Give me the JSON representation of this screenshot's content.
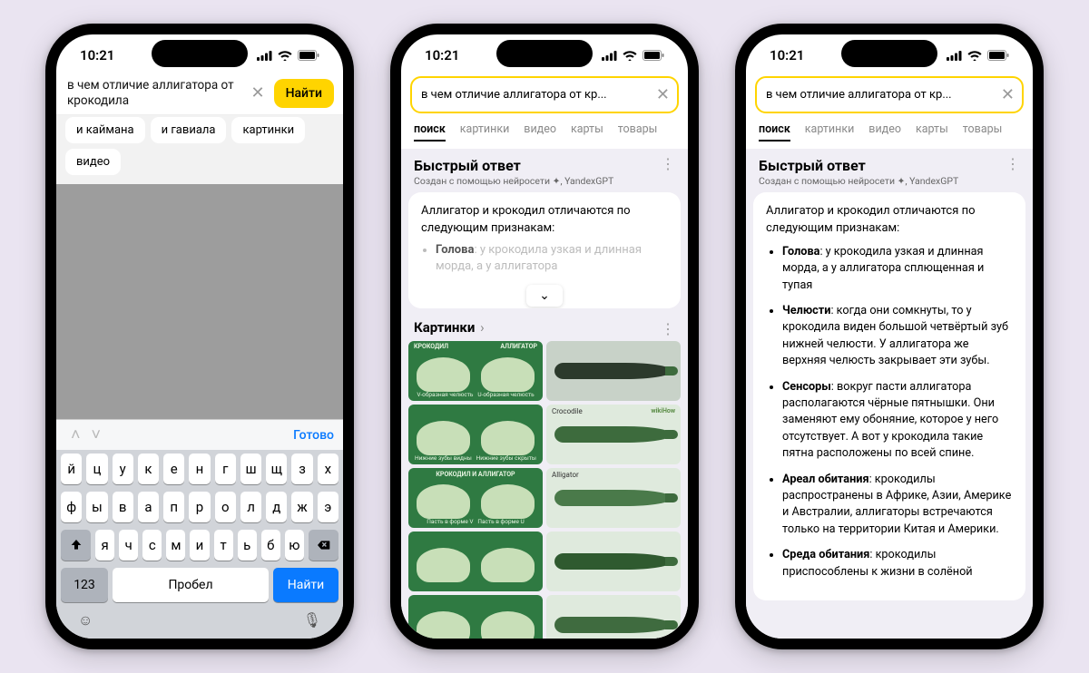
{
  "status": {
    "time": "10:21"
  },
  "phone1": {
    "query": "в чем отличие аллигатора от\nкрокодила",
    "search_button": "Найти",
    "chips": [
      "и каймана",
      "и гавиала",
      "картинки",
      "видео"
    ],
    "kbd_done": "Готово",
    "rows": [
      [
        "й",
        "ц",
        "у",
        "к",
        "е",
        "н",
        "г",
        "ш",
        "щ",
        "з",
        "х"
      ],
      [
        "ф",
        "ы",
        "в",
        "а",
        "п",
        "р",
        "о",
        "л",
        "д",
        "ж",
        "э"
      ],
      [
        "я",
        "ч",
        "с",
        "м",
        "и",
        "т",
        "ь",
        "б",
        "ю"
      ]
    ],
    "k123": "123",
    "space": "Пробел",
    "kfind": "Найти"
  },
  "search_query_short": "в чем отличие аллигатора от кр...",
  "tabs": [
    "поиск",
    "картинки",
    "видео",
    "карты",
    "товары"
  ],
  "answer": {
    "title": "Быстрый ответ",
    "subtitle": "Создан с помощью нейросети ✦, YandexGPT",
    "intro": "Аллигатор и крокодил отличаются по следующим признакам:",
    "teaser_head": "Голова",
    "teaser_text": ": у крокодила узкая и длинная морда, а у аллигатора",
    "points": [
      {
        "head": "Голова",
        "text": ": у крокодила узкая и длинная морда, а у аллигатора сплющенная и тупая"
      },
      {
        "head": "Челюсти",
        "text": ": когда они сомкнуты, то у крокодила виден большой четвёртый зуб нижней челюсти. У аллигатора же верхняя челюсть закрывает эти зубы."
      },
      {
        "head": "Сенсоры",
        "text": ": вокруг пасти аллигатора располагаются чёрные пятнышки. Они заменяют ему обоняние, которое у него отсутствует. А вот у крокодила такие пятна расположены по всей спине."
      },
      {
        "head": "Ареал обитания",
        "text": ": крокодилы распространены в Африке, Азии, Америке и Австралии, аллигаторы встречаются только на территории Китая и Америки."
      },
      {
        "head": "Среда обитания",
        "text": ": крокодилы приспособлены к жизни в солёной"
      }
    ]
  },
  "pics": {
    "title": "Картинки",
    "labels": {
      "krokodil": "КРОКОДИЛ",
      "alligator": "АЛЛИГАТОР",
      "vjaw": "V-образная челюсть",
      "ujaw": "U-образная челюсть",
      "lower": "Нижние зубы видны",
      "lower2": "Нижние зубы скрыты",
      "both": "КРОКОДИЛ И АЛЛИГАТОР",
      "pastv": "Пасть в форме V",
      "pastu": "Пасть в форме U",
      "crocodile_en": "Crocodile",
      "alligator_en": "Alligator",
      "wikihow": "wikiHow"
    }
  }
}
